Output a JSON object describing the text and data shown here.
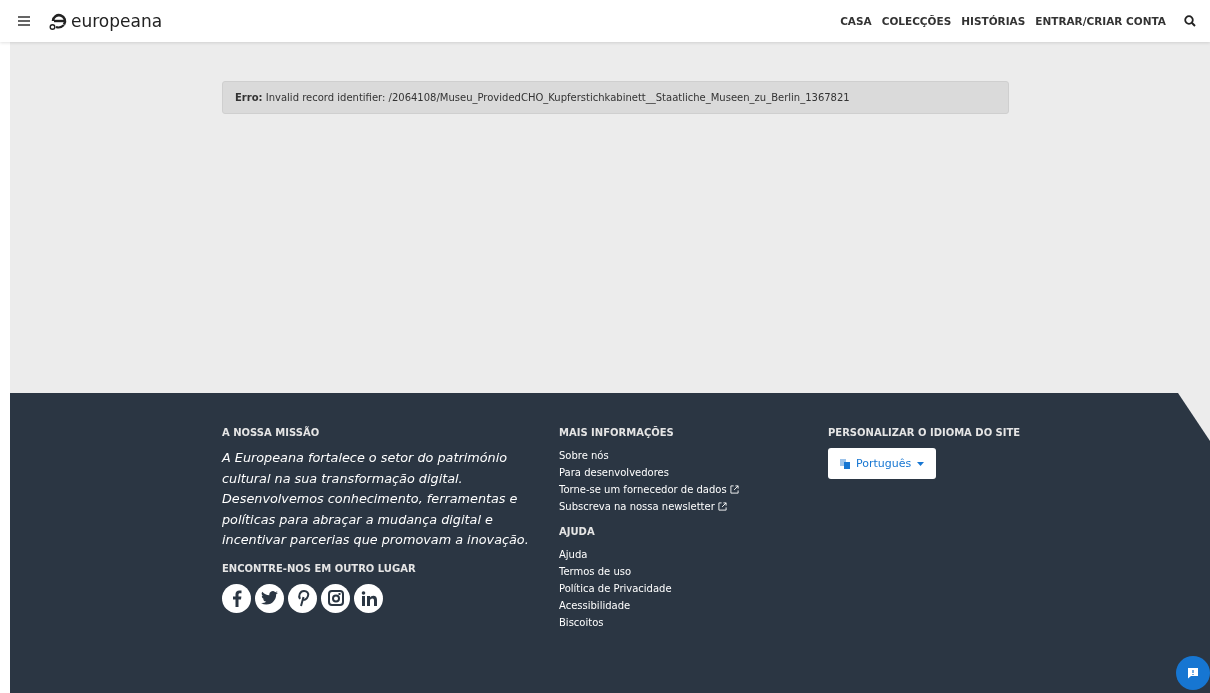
{
  "header": {
    "logo": "europeana",
    "nav": [
      "CASA",
      "COLECÇÕES",
      "HISTÓRIAS",
      "ENTRAR/CRIAR CONTA"
    ]
  },
  "error": {
    "text": "**Erro:** Invalid record identifier: /2064108/Museu_ProvidedCHO_Kupferstichkabinett__Staatliche_Museen_zu_Berlin_1367821"
  },
  "footer": {
    "mission": {
      "heading": "A NOSSA MISSÃO",
      "text": "A Europeana fortalece o setor do património cultural na sua transformação digital. Desenvolvemos conhecimento, ferramentas e políticas para abraçar a mudança digital e incentivar parcerias que promovam a inovação.",
      "social_heading": "ENCONTRE-NOS EM OUTRO LUGAR",
      "social": [
        {
          "kind": "facebook"
        },
        {
          "kind": "twitter"
        },
        {
          "kind": "pinterest"
        },
        {
          "kind": "instagram"
        },
        {
          "kind": "linkedin"
        }
      ]
    },
    "more_info": {
      "heading": "MAIS INFORMAÇÕES",
      "links": [
        {
          "label": "Sobre nós",
          "external": false
        },
        {
          "label": "Para desenvolvedores",
          "external": false
        },
        {
          "label": "Torne-se um fornecedor de dados",
          "external": true
        },
        {
          "label": "Subscreva na nossa newsletter",
          "external": true
        }
      ]
    },
    "help": {
      "heading": "AJUDA",
      "links": [
        {
          "label": "Ajuda",
          "external": false
        },
        {
          "label": "Termos de uso",
          "external": false
        },
        {
          "label": "Política de Privacidade",
          "external": false
        },
        {
          "label": "Acessibilidade",
          "external": false
        },
        {
          "label": "Biscoitos",
          "external": false
        }
      ]
    },
    "language": {
      "heading": "PERSONALIZAR O IDIOMA DO SITE",
      "value": "Português"
    }
  }
}
